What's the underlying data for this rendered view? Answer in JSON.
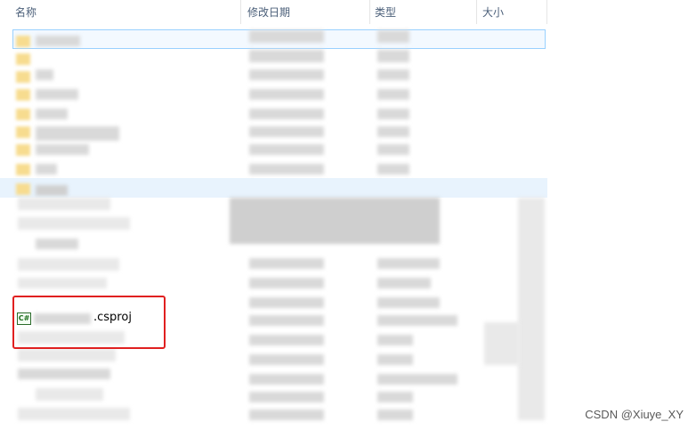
{
  "columns": [
    "名称",
    "修改日期",
    "类型",
    "大小"
  ],
  "selected_file": {
    "name_visible": ".csproj",
    "icon": "csharp-project-icon",
    "icon_text": "C#"
  },
  "watermark": "CSDN @Xiuye_XY"
}
